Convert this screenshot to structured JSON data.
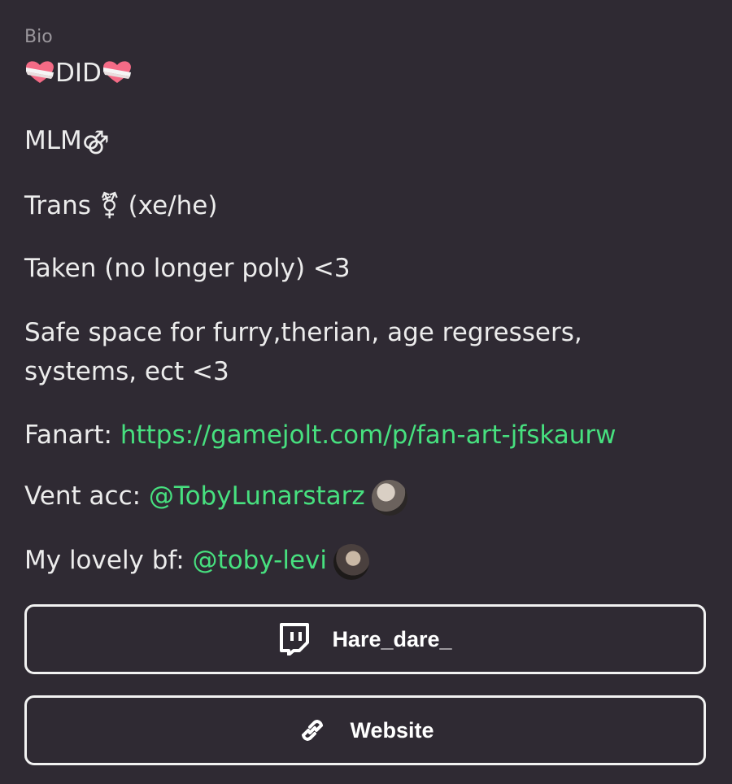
{
  "bio": {
    "label": "Bio",
    "line1_text": "DID",
    "line2_text": "MLM⚣",
    "line3_text": "Trans ⚧ (xe/he)",
    "line4_text": "Taken (no longer poly) <3",
    "line5a_text": "Safe space for furry,therian, age regressers,",
    "line5b_text": "systems, ect <3",
    "fanart_prefix": "Fanart: ",
    "fanart_link": "https://gamejolt.com/p/fan-art-jfskaurw",
    "vent_prefix": "Vent acc: ",
    "vent_mention": "@TobyLunarstarz",
    "bf_prefix": "My lovely bf: ",
    "bf_mention": "@toby-levi"
  },
  "links": {
    "twitch_label": "Hare_dare_",
    "website_label": "Website"
  },
  "colors": {
    "background": "#2f2a33",
    "link": "#47e07f",
    "text": "#ececec"
  },
  "icons": [
    "mending-heart-icon",
    "twitch-icon",
    "link-icon"
  ]
}
